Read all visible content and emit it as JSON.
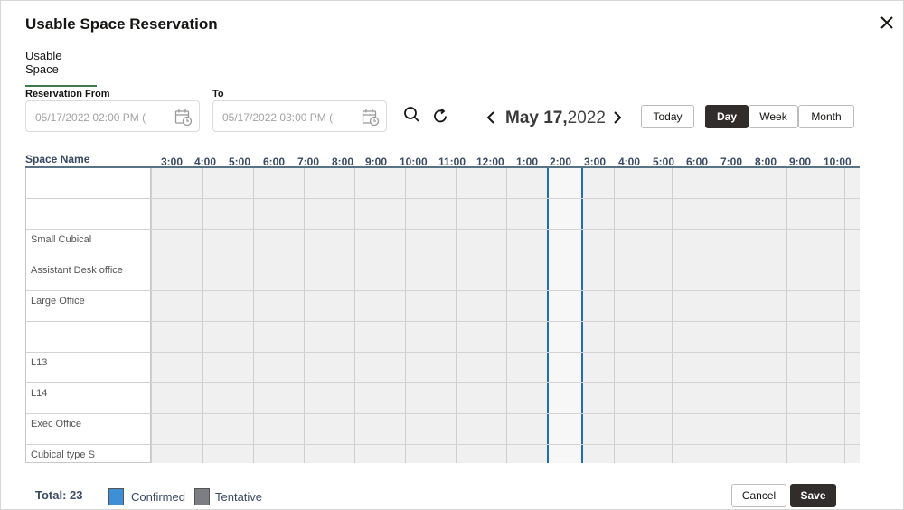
{
  "dialog": {
    "title": "Usable Space Reservation",
    "close_icon": "close-icon"
  },
  "tabs": [
    {
      "label": "Usable Space",
      "active": true
    }
  ],
  "reservation": {
    "from_label": "Reservation From",
    "from_value": "05/17/2022 02:00 PM  (",
    "to_label": "To",
    "to_value": "05/17/2022 03:00 PM  ("
  },
  "toolbar": {
    "search_icon": "search-icon",
    "refresh_icon": "refresh-icon",
    "prev_icon": "chevron-left-icon",
    "next_icon": "chevron-right-icon",
    "date_month_day": "May 17,",
    "date_year": "2022",
    "today_label": "Today",
    "views": [
      "Day",
      "Week",
      "Month"
    ],
    "active_view": "Day"
  },
  "grid": {
    "space_name_header": "Space Name",
    "hours": [
      "3:00",
      "4:00",
      "5:00",
      "6:00",
      "7:00",
      "8:00",
      "9:00",
      "10:00",
      "11:00",
      "12:00",
      "1:00",
      "2:00",
      "3:00",
      "4:00",
      "5:00",
      "6:00",
      "7:00",
      "8:00",
      "9:00",
      "10:00"
    ],
    "rows": [
      "",
      "",
      "Small Cubical",
      "Assistant Desk office",
      "Large Office",
      "",
      "L13",
      "L14",
      "Exec Office",
      "Cubical type S"
    ],
    "selection_color": "#1f6bb5"
  },
  "footer": {
    "total": "Total: 23",
    "legend": [
      {
        "label": "Confirmed",
        "color": "#3d8fd6"
      },
      {
        "label": "Tentative",
        "color": "#7d7e84"
      }
    ],
    "cancel_label": "Cancel",
    "save_label": "Save"
  }
}
